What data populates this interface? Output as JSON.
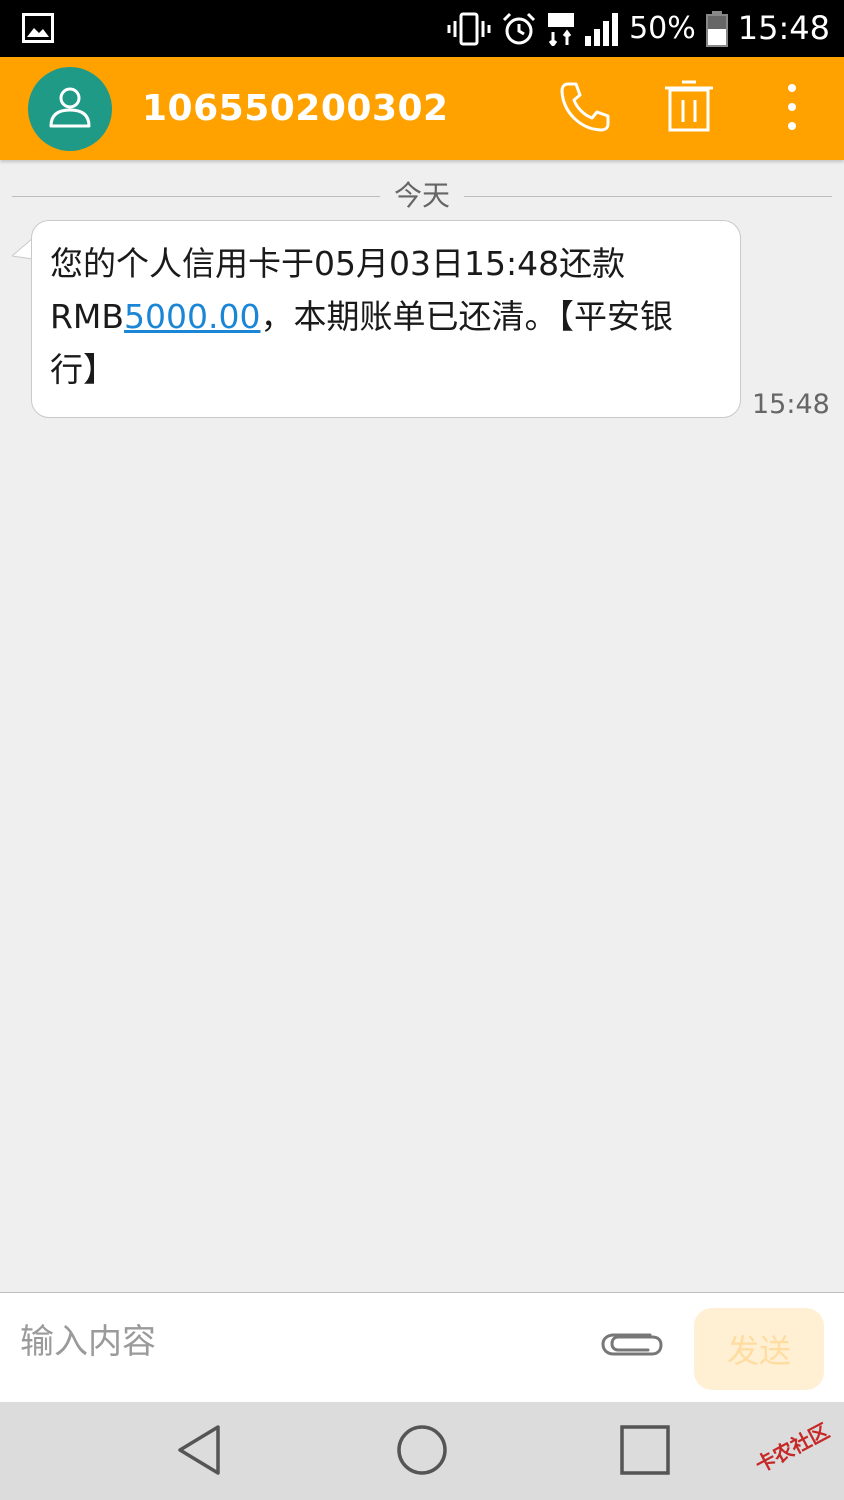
{
  "status_bar": {
    "battery_text": "50%",
    "time": "15:48"
  },
  "header": {
    "contact_number": "106550200302",
    "accent_color": "#ffa200",
    "avatar_color": "#1f9a87"
  },
  "conversation": {
    "date_label": "今天",
    "messages": [
      {
        "text_before": "您的个人信用卡于05月03日15:48还款RMB",
        "link_text": "5000.00",
        "text_after": "，本期账单已还清。【平安银行】",
        "time": "15:48",
        "direction": "incoming"
      }
    ]
  },
  "compose": {
    "placeholder": "输入内容",
    "send_label": "发送"
  },
  "watermark": {
    "text": "卡农社区"
  },
  "icons": {
    "status": [
      "gallery-icon",
      "vibrate-icon",
      "alarm-icon",
      "lte-icon",
      "signal-icon",
      "battery-icon"
    ],
    "header": [
      "contact-avatar-icon",
      "phone-icon",
      "trash-icon",
      "overflow-menu-icon"
    ],
    "compose": [
      "paperclip-icon"
    ],
    "nav": [
      "back-icon",
      "home-icon",
      "recents-icon"
    ]
  }
}
